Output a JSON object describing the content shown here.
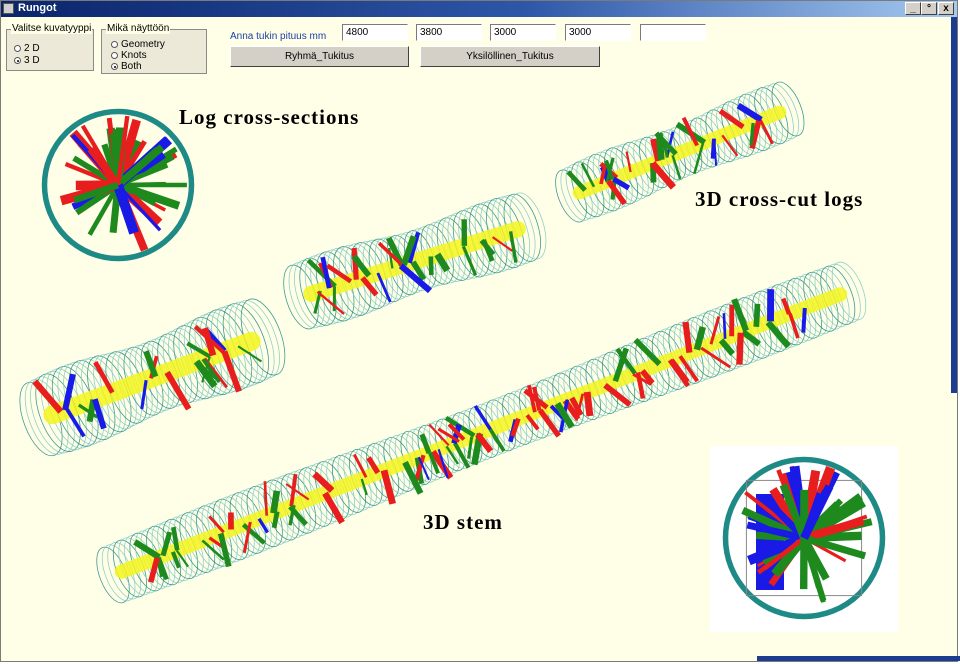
{
  "window": {
    "title": "Rungot",
    "minimize": "_",
    "maximize": "°",
    "close": "x"
  },
  "image_type_group": {
    "legend": "Valitse kuvatyyppi",
    "options": [
      {
        "label": "2 D",
        "selected": false
      },
      {
        "label": "3 D",
        "selected": true
      }
    ]
  },
  "display_group": {
    "legend": "Mikä näyttöön",
    "options": [
      {
        "label": "Geometry",
        "selected": false
      },
      {
        "label": "Knots",
        "selected": false
      },
      {
        "label": "Both",
        "selected": true
      }
    ]
  },
  "log_length": {
    "label": "Anna tukin pituus mm",
    "values": [
      "4800",
      "3800",
      "3000",
      "3000",
      ""
    ]
  },
  "buttons": {
    "group": "Ryhmä_Tukitus",
    "single": "Yksilöllinen_Tukitus"
  },
  "captions": {
    "cross_sections": "Log cross-sections",
    "cross_cut": "3D cross-cut logs",
    "stem": "3D stem"
  },
  "colors": {
    "background": "#ffffe8",
    "shell": "#1f8a86",
    "shell_light": "#7fc7c4",
    "knot_red": "#e81e1e",
    "knot_green": "#1e8a1e",
    "knot_blue": "#1a1ae6",
    "pith": "#f5f51e"
  }
}
